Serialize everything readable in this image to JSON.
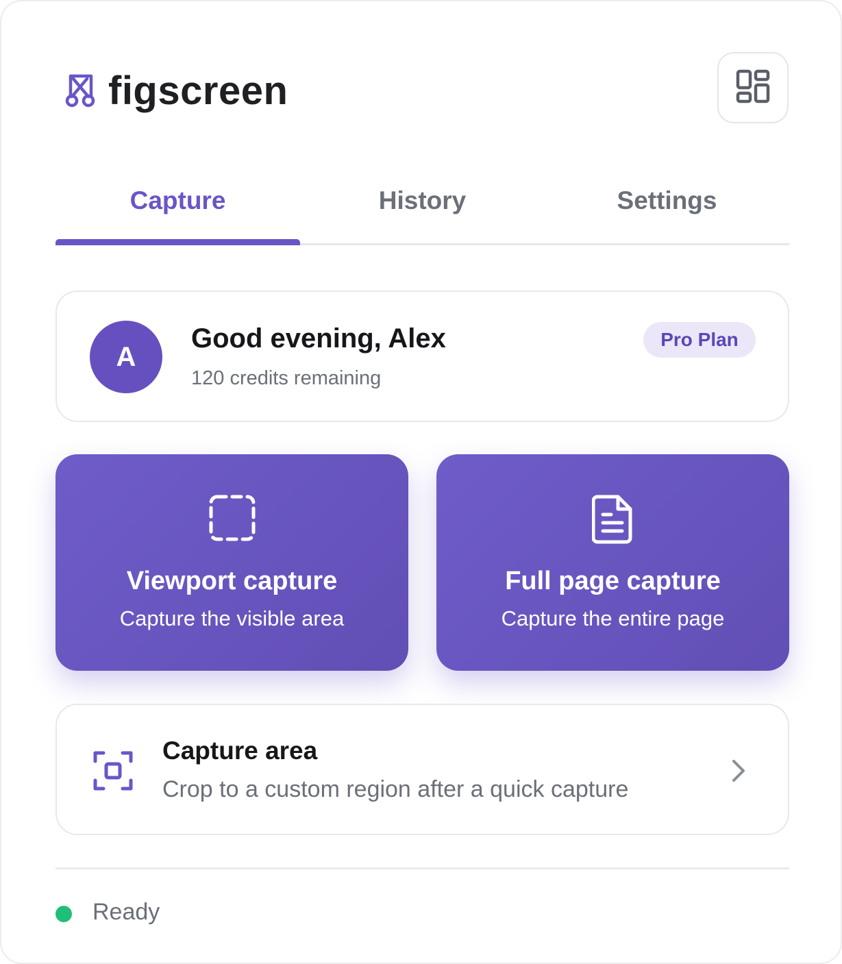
{
  "header": {
    "app_name": "figscreen",
    "logo_icon": "scissors-frame-icon",
    "apps_button_icon": "grid-layout-icon"
  },
  "tabs": [
    {
      "label": "Capture",
      "active": true
    },
    {
      "label": "History",
      "active": false
    },
    {
      "label": "Settings",
      "active": false
    }
  ],
  "user": {
    "avatar_initial": "A",
    "greeting": "Good evening, Alex",
    "credits": "120 credits remaining",
    "plan": "Pro Plan"
  },
  "actions": {
    "viewport": {
      "title": "Viewport capture",
      "subtitle": "Capture the visible area",
      "icon": "dashed-square-icon"
    },
    "fullpage": {
      "title": "Full page capture",
      "subtitle": "Capture the entire page",
      "icon": "document-icon"
    }
  },
  "capture_area": {
    "title": "Capture area",
    "subtitle": "Crop to a custom region after a quick capture",
    "icon": "crop-region-icon"
  },
  "status": {
    "text": "Ready",
    "color": "#1fbf7a"
  },
  "colors": {
    "accent": "#6a55c7",
    "button_gradient_start": "#6f5cc9",
    "button_gradient_end": "#624fb5"
  }
}
